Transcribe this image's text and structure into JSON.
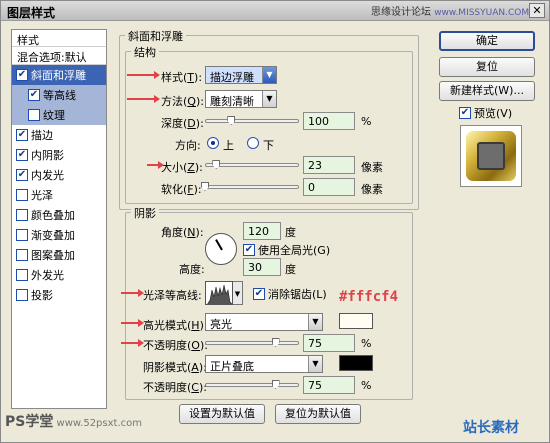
{
  "window": {
    "title": "图层样式",
    "close_glyph": "✕"
  },
  "watermark_top": {
    "text": "思缘设计论坛",
    "url": "www.MISSYUAN.COM"
  },
  "style_list": {
    "header": "样式",
    "blend": "混合选项:默认",
    "items": [
      {
        "label": "斜面和浮雕",
        "checked": true
      },
      {
        "label": "等高线",
        "checked": true
      },
      {
        "label": "纹理",
        "checked": false
      },
      {
        "label": "描边",
        "checked": true
      },
      {
        "label": "内阴影",
        "checked": true
      },
      {
        "label": "内发光",
        "checked": true
      },
      {
        "label": "光泽",
        "checked": false
      },
      {
        "label": "颜色叠加",
        "checked": false
      },
      {
        "label": "渐变叠加",
        "checked": false
      },
      {
        "label": "图案叠加",
        "checked": false
      },
      {
        "label": "外发光",
        "checked": false
      },
      {
        "label": "投影",
        "checked": false
      }
    ]
  },
  "bevel": {
    "section_title": "斜面和浮雕",
    "structure_title": "结构",
    "style_label": "样式(",
    "style_key": "T",
    "style_end": "):",
    "style_value": "描边浮雕",
    "method_label": "方法(",
    "method_key": "Q",
    "method_end": "):",
    "method_value": "雕刻清晰",
    "depth_label": "深度(",
    "depth_key": "D",
    "depth_end": "):",
    "depth_value": "100",
    "depth_unit": "%",
    "direction_label": "方向:",
    "direction_up": "上",
    "direction_down": "下",
    "size_label": "大小(",
    "size_key": "Z",
    "size_end": "):",
    "size_value": "23",
    "size_unit": "像素",
    "soften_label": "软化(",
    "soften_key": "F",
    "soften_end": "):",
    "soften_value": "0",
    "soften_unit": "像素"
  },
  "shading": {
    "title": "阴影",
    "angle_label": "角度(",
    "angle_key": "N",
    "angle_end": "):",
    "angle_value": "120",
    "angle_unit": "度",
    "global_light": "使用全局光(G)",
    "altitude_label": "高度:",
    "altitude_value": "30",
    "altitude_unit": "度",
    "gloss_label": "光泽等高线:",
    "antialias": "消除锯齿(L)",
    "highlight_label": "高光模式(",
    "highlight_key": "H",
    "highlight_end": "):",
    "highlight_mode": "亮光",
    "highlight_color": "#fffcf4",
    "hl_opacity_label": "不透明度(",
    "hl_opacity_key": "O",
    "hl_opacity_end": "):",
    "hl_opacity_value": "75",
    "hl_opacity_unit": "%",
    "shadow_label": "阴影模式(",
    "shadow_key": "A",
    "shadow_end": "):",
    "shadow_mode": "正片叠底",
    "shadow_color": "#000000",
    "sh_opacity_label": "不透明度(",
    "sh_opacity_key": "C",
    "sh_opacity_end": "):",
    "sh_opacity_value": "75",
    "sh_opacity_unit": "%"
  },
  "annotation_hex": "#fffcf4",
  "bottom_buttons": {
    "set_default": "设置为默认值",
    "reset_default": "复位为默认值"
  },
  "right_buttons": {
    "ok": "确定",
    "reset": "复位",
    "new_style": "新建样式(W)...",
    "preview": "预览(V)"
  },
  "watermark_bottom": {
    "ps": "PS学堂",
    "url": "www.52psxt.com",
    "brand": "站长素材"
  },
  "sliders": {
    "depth": 0.28,
    "size": 0.12,
    "soften": 0.0,
    "hl_opacity": 0.75,
    "sh_opacity": 0.75
  }
}
